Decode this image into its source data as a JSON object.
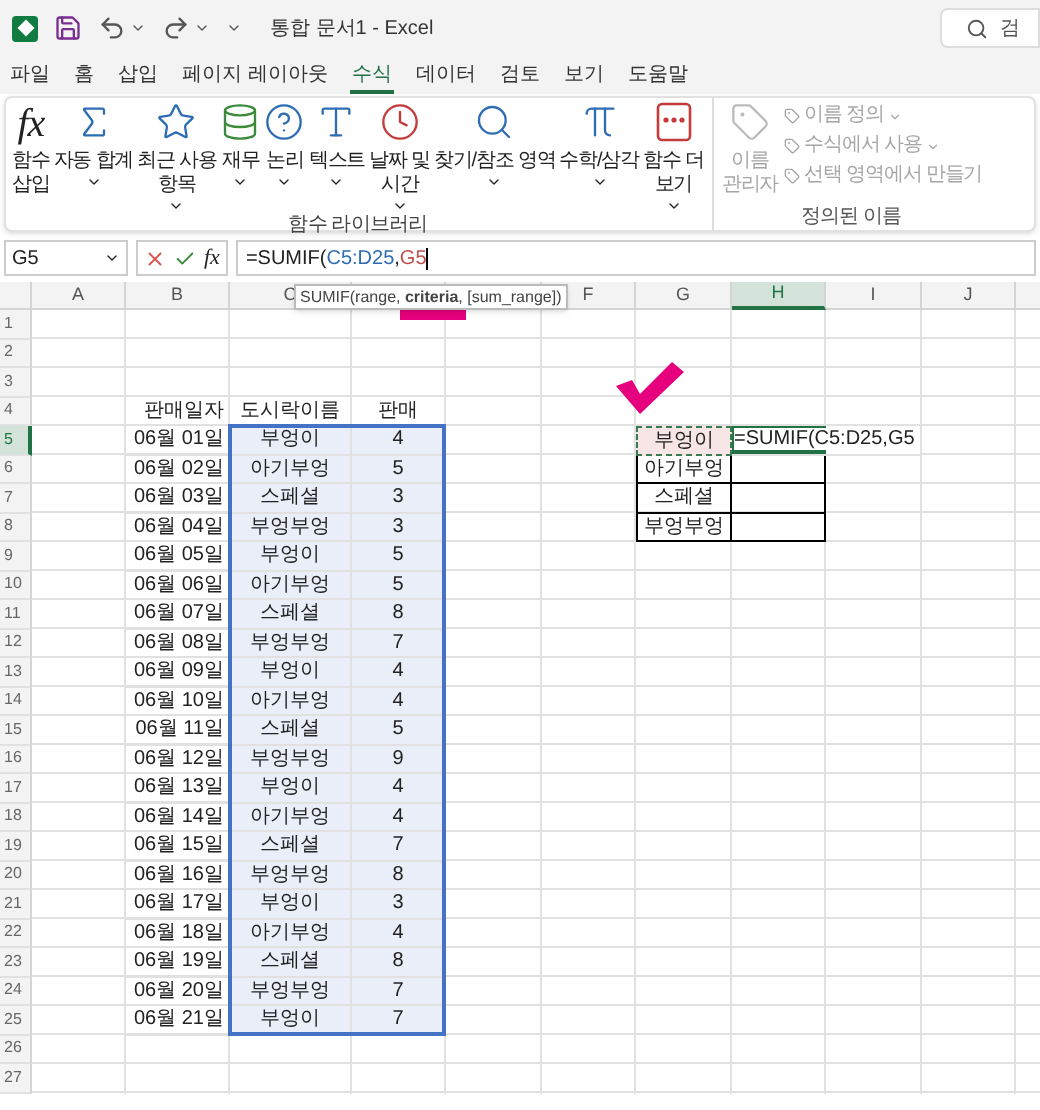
{
  "title_bar": {
    "title": "통합 문서1 - Excel",
    "search_placeholder": "검"
  },
  "menu_tabs": [
    {
      "label": "파일",
      "selected": false
    },
    {
      "label": "홈",
      "selected": false
    },
    {
      "label": "삽입",
      "selected": false
    },
    {
      "label": "페이지 레이아웃",
      "selected": false
    },
    {
      "label": "수식",
      "selected": true
    },
    {
      "label": "데이터",
      "selected": false
    },
    {
      "label": "검토",
      "selected": false
    },
    {
      "label": "보기",
      "selected": false
    },
    {
      "label": "도움말",
      "selected": false
    }
  ],
  "ribbon": {
    "groups": [
      {
        "label": "함수 라이브러리",
        "disabled": false,
        "items": [
          {
            "lines": [
              "함수",
              "삽입"
            ],
            "icon_text": "fx",
            "dropdown": false
          },
          {
            "lines": [
              "자동 합계"
            ],
            "dropdown": true
          },
          {
            "lines": [
              "최근 사용",
              "항목"
            ],
            "dropdown": true
          },
          {
            "lines": [
              "재무"
            ],
            "dropdown": true
          },
          {
            "lines": [
              "논리"
            ],
            "dropdown": true
          },
          {
            "lines": [
              "텍스트"
            ],
            "dropdown": true
          },
          {
            "lines": [
              "날짜 및",
              "시간"
            ],
            "dropdown": true
          },
          {
            "lines": [
              "찾기/참조 영역"
            ],
            "dropdown": true
          },
          {
            "lines": [
              "수학/삼각"
            ],
            "dropdown": true
          },
          {
            "lines": [
              "함수 더",
              "보기"
            ],
            "dropdown": true
          }
        ]
      },
      {
        "label": "정의된 이름",
        "disabled": true,
        "items": [
          {
            "lines": [
              "이름",
              "관리자"
            ],
            "dropdown": false
          }
        ],
        "small_items": [
          {
            "label": "이름 정의",
            "dropdown": true
          },
          {
            "label": "수식에서 사용",
            "dropdown": true
          },
          {
            "label": "선택 영역에서 만들기",
            "dropdown": false
          }
        ]
      }
    ]
  },
  "formula_bar": {
    "name_box": "G5",
    "fx": "fx",
    "formula_parts": [
      {
        "text": "=SUMIF(",
        "color": "#222222"
      },
      {
        "text": "C5:D25",
        "color": "#2e6db4"
      },
      {
        "text": ",",
        "color": "#222222"
      },
      {
        "text": "G5",
        "color": "#c0504d"
      }
    ]
  },
  "tooltip": "SUMIF(range, **criteria**, [sum_range])",
  "sheet": {
    "columns": [
      {
        "label": "A",
        "selected": false
      },
      {
        "label": "B",
        "selected": false
      },
      {
        "label": "C",
        "selected": false
      },
      {
        "selected": false
      },
      {
        "selected": false
      },
      {
        "label": "F",
        "selected": false
      },
      {
        "label": "G",
        "selected": false
      },
      {
        "label": "H",
        "selected": true
      },
      {
        "label": "I",
        "selected": false
      },
      {
        "label": "J",
        "selected": false
      }
    ],
    "rows": [
      {
        "label": "1",
        "selected": false
      },
      {
        "label": "2",
        "selected": false
      },
      {
        "label": "3",
        "selected": false
      },
      {
        "label": "4",
        "selected": false
      },
      {
        "label": "5",
        "selected": true
      },
      {
        "label": "6",
        "selected": false
      },
      {
        "label": "7",
        "selected": false
      },
      {
        "label": "8",
        "selected": false
      },
      {
        "label": "9",
        "selected": false
      },
      {
        "label": "10",
        "selected": false
      },
      {
        "label": "11",
        "selected": false
      },
      {
        "label": "12",
        "selected": false
      },
      {
        "label": "13",
        "selected": false
      },
      {
        "label": "14",
        "selected": false
      },
      {
        "label": "15",
        "selected": false
      },
      {
        "label": "16",
        "selected": false
      },
      {
        "label": "17",
        "selected": false
      },
      {
        "label": "18",
        "selected": false
      },
      {
        "label": "19",
        "selected": false
      },
      {
        "label": "20",
        "selected": false
      },
      {
        "label": "21",
        "selected": false
      },
      {
        "label": "22",
        "selected": false
      },
      {
        "label": "23",
        "selected": false
      },
      {
        "label": "24",
        "selected": false
      },
      {
        "label": "25",
        "selected": false
      },
      {
        "label": "26",
        "selected": false
      },
      {
        "label": "27",
        "selected": false
      }
    ],
    "table": {
      "range_selected": true,
      "header": [
        "판매일자",
        "도시락이름",
        "판매"
      ],
      "rows": [
        [
          "06월 01일",
          "부엉이",
          "4"
        ],
        [
          "06월 02일",
          "아기부엉",
          "5"
        ],
        [
          "06월 03일",
          "스페셜",
          "3"
        ],
        [
          "06월 04일",
          "부엉부엉",
          "3"
        ],
        [
          "06월 05일",
          "부엉이",
          "5"
        ],
        [
          "06월 06일",
          "아기부엉",
          "5"
        ],
        [
          "06월 07일",
          "스페셜",
          "8"
        ],
        [
          "06월 08일",
          "부엉부엉",
          "7"
        ],
        [
          "06월 09일",
          "부엉이",
          "4"
        ],
        [
          "06월 10일",
          "아기부엉",
          "4"
        ],
        [
          "06월 11일",
          "스페셜",
          "5"
        ],
        [
          "06월 12일",
          "부엉부엉",
          "9"
        ],
        [
          "06월 13일",
          "부엉이",
          "4"
        ],
        [
          "06월 14일",
          "아기부엉",
          "4"
        ],
        [
          "06월 15일",
          "스페셜",
          "7"
        ],
        [
          "06월 16일",
          "부엉부엉",
          "8"
        ],
        [
          "06월 17일",
          "부엉이",
          "3"
        ],
        [
          "06월 18일",
          "아기부엉",
          "4"
        ],
        [
          "06월 19일",
          "스페셜",
          "8"
        ],
        [
          "06월 20일",
          "부엉부엉",
          "7"
        ],
        [
          "06월 21일",
          "부엉이",
          "7"
        ]
      ]
    },
    "lookup": [
      {
        "name": "부엉이",
        "marked": true
      },
      {
        "name": "아기부엉",
        "marked": false
      },
      {
        "name": "스페셜",
        "marked": false
      },
      {
        "name": "부엉부엉",
        "marked": false
      }
    ],
    "active_cell_text": "=SUMIF(C5:D25,G5"
  }
}
